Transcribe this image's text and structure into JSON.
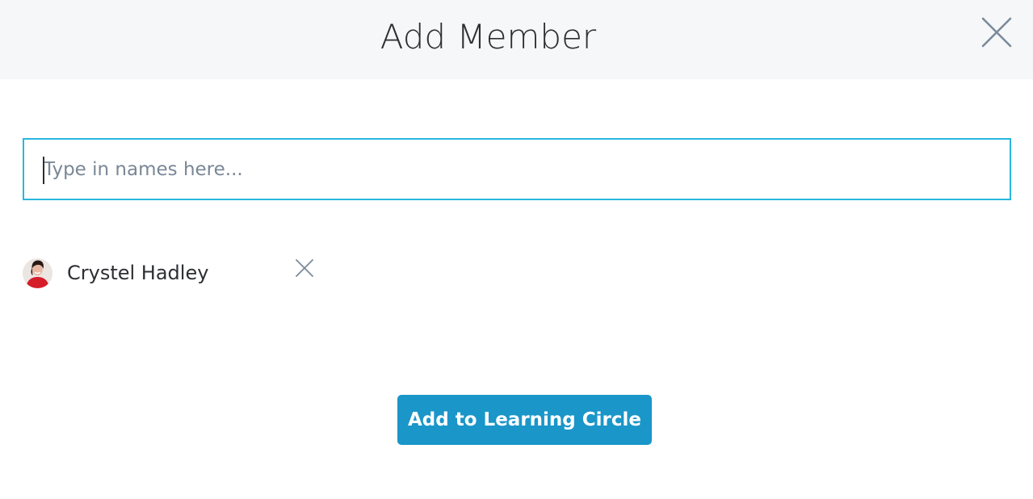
{
  "dialog": {
    "title": "Add Member",
    "close_icon": "close-icon"
  },
  "search": {
    "value": "",
    "placeholder": "Type in names here..."
  },
  "selected_members": [
    {
      "name": "Crystel Hadley",
      "avatar_icon": "avatar",
      "remove_icon": "close-icon"
    }
  ],
  "actions": {
    "submit_label": "Add to Learning Circle"
  },
  "colors": {
    "header_background": "#f6f7f9",
    "input_focus_border": "#28b6de",
    "primary_button": "#1a96c9",
    "text": "#2d2f33",
    "placeholder": "#7a8796",
    "icon": "#7c8a9a"
  }
}
